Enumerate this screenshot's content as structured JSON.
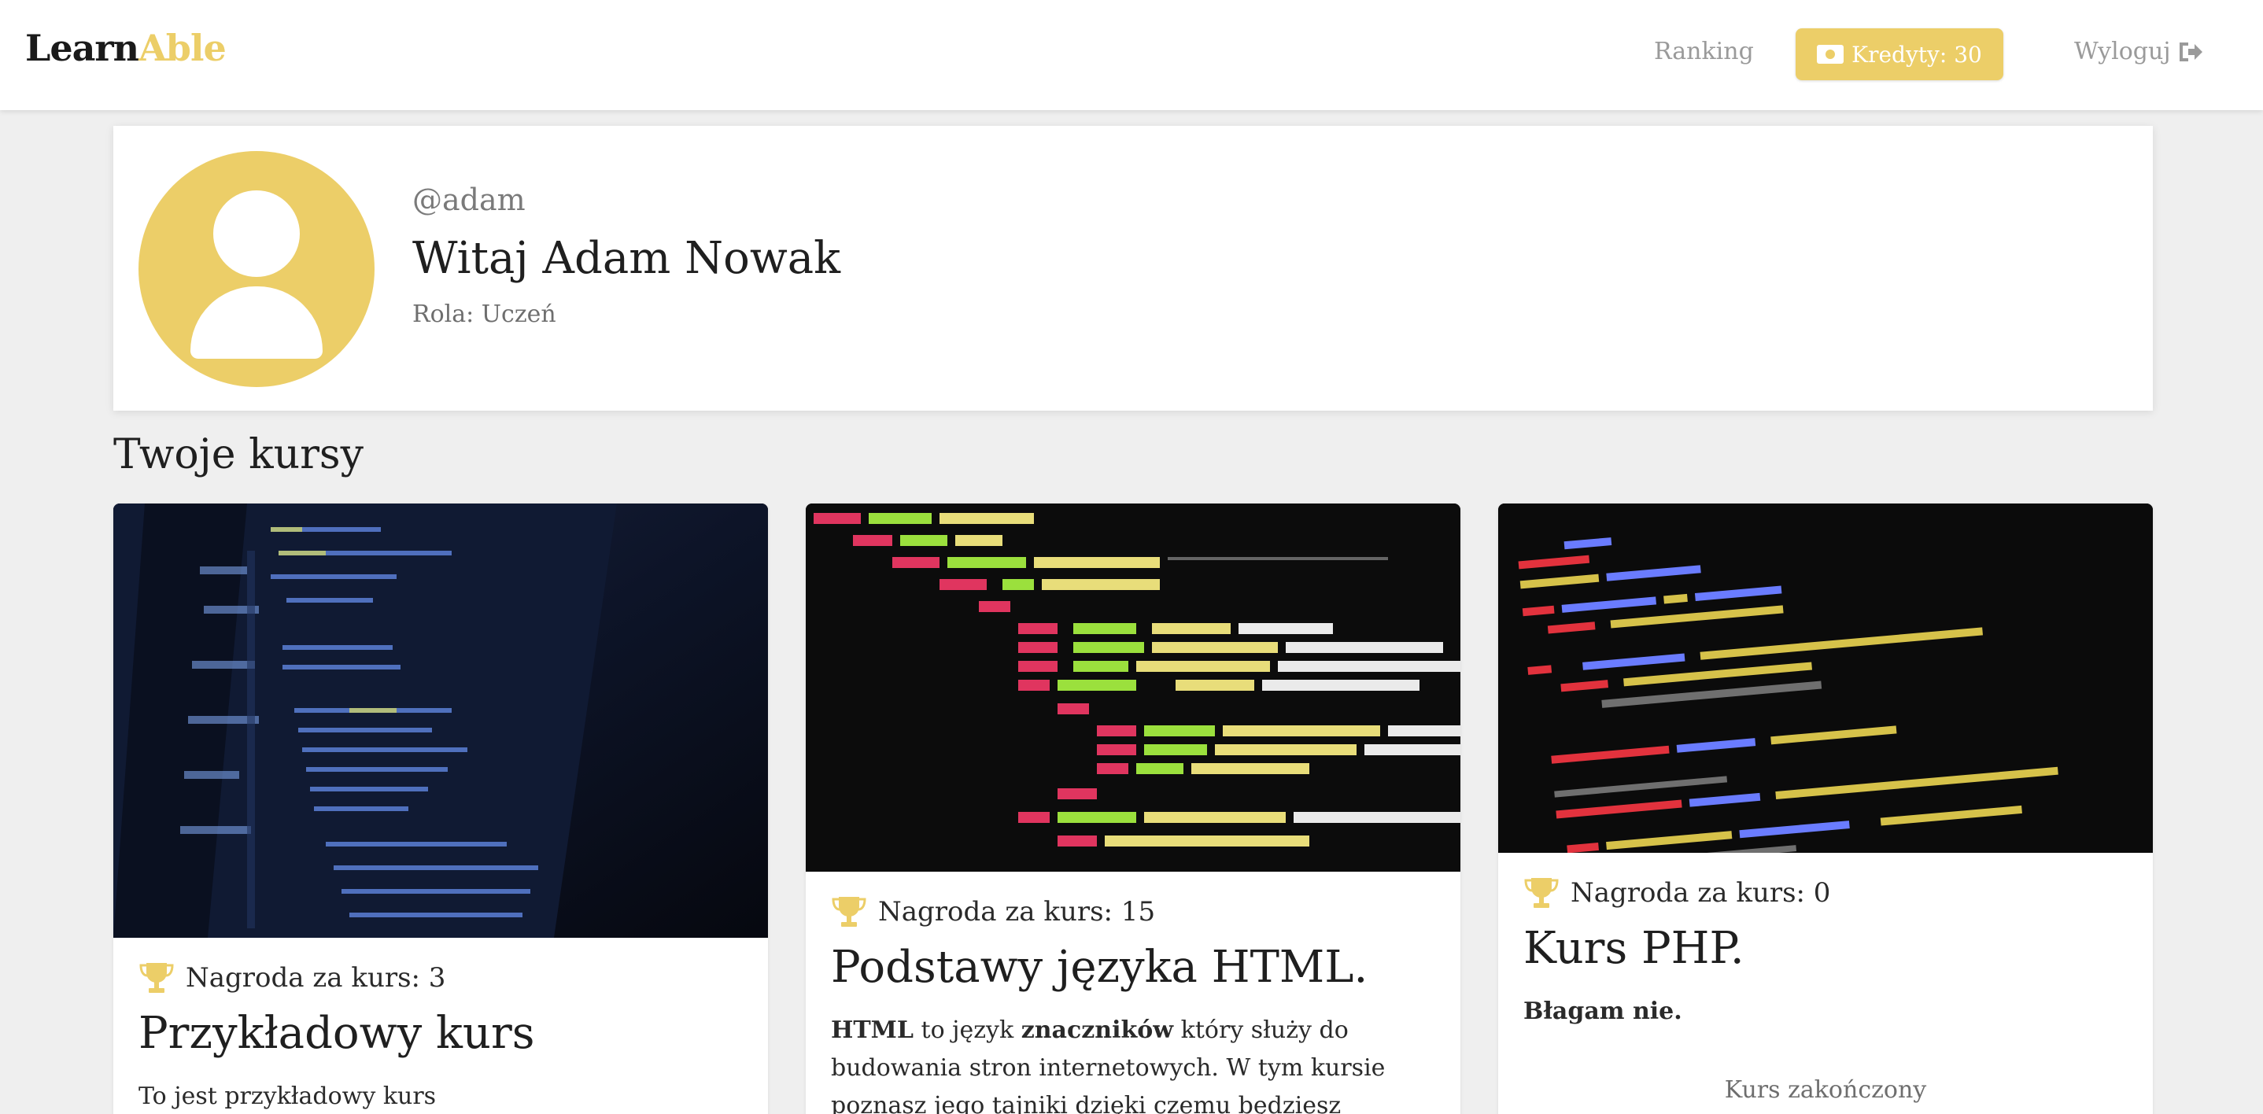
{
  "navbar": {
    "brand_part1": "Learn",
    "brand_part2": "Able",
    "ranking_label": "Ranking",
    "credits_label": "Kredyty: 30",
    "logout_label": "Wyloguj",
    "colors": {
      "accent": "#ecce68",
      "muted": "#9a9a9a"
    }
  },
  "profile": {
    "username": "@adam",
    "greeting": "Witaj Adam Nowak",
    "role": "Rola: Uczeń"
  },
  "section": {
    "title": "Twoje kursy"
  },
  "courses": [
    {
      "reward": "Nagroda za kurs: 3",
      "title": "Przykładowy kurs",
      "description": "To jest przykładowy kurs"
    },
    {
      "reward": "Nagroda za kurs: 15",
      "title": "Podstawy języka HTML.",
      "description_parts": [
        "HTML",
        " to język ",
        "znaczników",
        " który służy do budowania stron internetowych. W tym kursie poznasz jego tajniki dzięki czemu będziesz wstanie sam zbudować"
      ]
    },
    {
      "reward": "Nagroda za kurs: 0",
      "title": "Kurs PHP.",
      "description": "Błagam nie.",
      "status": "Kurs zakończony"
    }
  ],
  "icons": [
    "cash-icon",
    "logout-icon",
    "avatar-icon",
    "trophy-icon"
  ]
}
